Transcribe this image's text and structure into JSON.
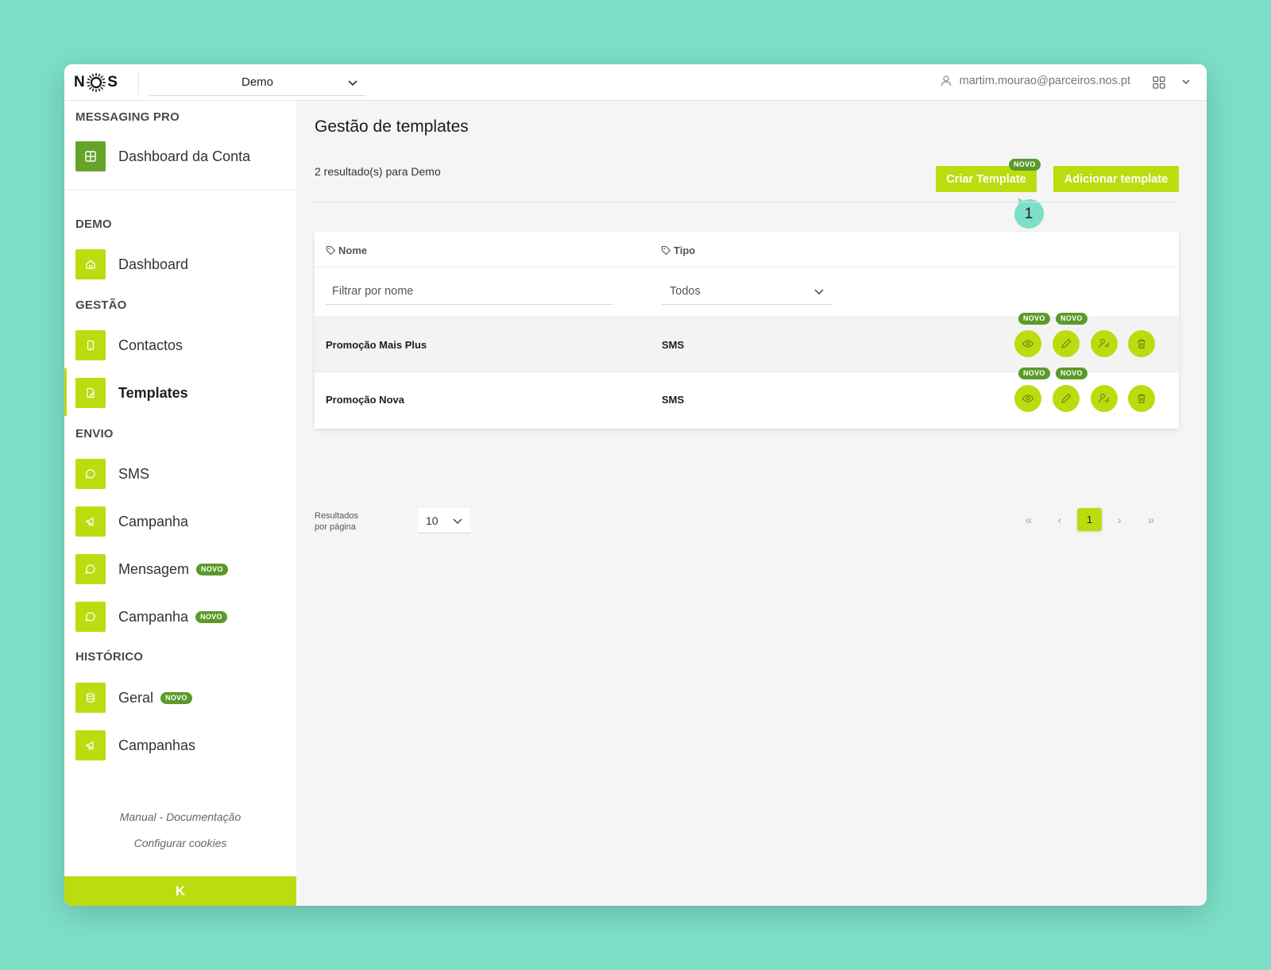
{
  "topbar": {
    "logo_left": "N",
    "logo_right": "S",
    "account_selected": "Demo",
    "user_email": "martim.mourao@parceiros.nos.pt"
  },
  "sidebar": {
    "section_messaging_pro": "MESSAGING PRO",
    "dashboard_conta": "Dashboard da Conta",
    "section_demo": "DEMO",
    "dashboard": "Dashboard",
    "section_gestao": "GESTÃO",
    "contactos": "Contactos",
    "templates": "Templates",
    "section_envio": "ENVIO",
    "sms": "SMS",
    "campanha": "Campanha",
    "mensagem": "Mensagem",
    "campanha_novo": "Campanha",
    "section_historico": "HISTÓRICO",
    "geral": "Geral",
    "campanhas": "Campanhas",
    "badge_novo": "NOVO",
    "manual_link": "Manual - Documentação",
    "cookies_link": "Configurar cookies",
    "collapse_label": "K"
  },
  "main": {
    "title": "Gestão de templates",
    "result_count": "2 resultado(s) para Demo",
    "create_button": "Criar Template",
    "create_badge": "NOVO",
    "add_button": "Adicionar template",
    "step_marker": "1"
  },
  "table": {
    "col_name": "Nome",
    "col_type": "Tipo",
    "filter_name_placeholder": "Filtrar por nome",
    "filter_type_selected": "Todos",
    "action_badge": "NOVO",
    "rows": [
      {
        "name": "Promoção Mais Plus",
        "type": "SMS"
      },
      {
        "name": "Promoção Nova",
        "type": "SMS"
      }
    ]
  },
  "pagination": {
    "rpp_label_1": "Resultados",
    "rpp_label_2": "por página",
    "rpp_value": "10",
    "first": "«",
    "prev": "‹",
    "current": "1",
    "next": "›",
    "last": "»"
  },
  "colors": {
    "accent": "#bcdc0f",
    "accent_dark": "#66a32b",
    "badge": "#5a9a2a",
    "background": "#7ddfc7",
    "marker": "#7ddfc7"
  },
  "icons": {
    "dashboard_conta": "grid-icon",
    "dashboard": "home-icon",
    "contactos": "phone-icon",
    "templates": "edit-doc-icon",
    "sms": "chat-icon",
    "campanha": "megaphone-icon",
    "mensagem": "chat-icon",
    "geral": "database-icon",
    "campanhas": "megaphone-icon",
    "row_actions": [
      "eye-icon",
      "pencil-icon",
      "user-assign-icon",
      "trash-icon"
    ]
  }
}
